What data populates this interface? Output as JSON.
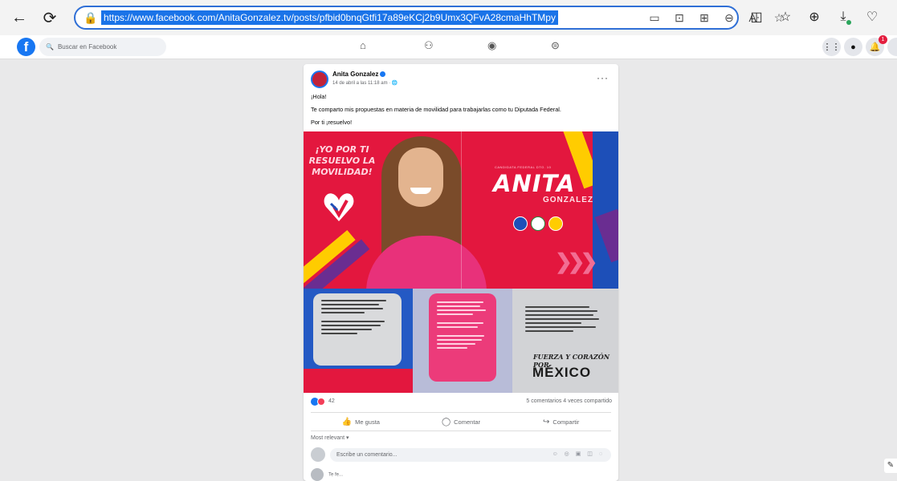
{
  "browser": {
    "url": "https://www.facebook.com/AnitaGonzalez.tv/posts/pfbid0bnqGtfi17a89eKCj2b9Umx3QFvA28cmaHhTMpy",
    "back_icon": "←",
    "reload_icon": "⟳"
  },
  "facebook": {
    "search_placeholder": "Buscar en Facebook",
    "notification_count": "1"
  },
  "post": {
    "author": "Anita Gonzalez",
    "date": "14 de abril a las 11:18 am · 🌐",
    "more": "···",
    "text_line1": "¡Hola!",
    "text_line2": "Te comparto mis propuestas en materia de movilidad para trabajarlas como tu Diputada Federal.",
    "text_line3": "Por ti ¡resuelvo!"
  },
  "campaign": {
    "slogan": "¡YO POR TI RESUELVO LA MOVILIDAD!",
    "subtitle": "CANDIDATA FEDERAL DTO. 10",
    "first_name": "ANITA",
    "last_name": "GONZALEZ",
    "fuerza": "FUERZA Y CORAZÓN POR",
    "mexico": "MÉXICO"
  },
  "reactions": {
    "count": "42",
    "stats": "5 comentarios  4 veces compartido"
  },
  "actions": {
    "like": "Me gusta",
    "comment": "Comentar",
    "share": "Compartir"
  },
  "comments": {
    "filter": "Most relevant ▾",
    "placeholder": "Escribe un comentario...",
    "icons": "☺ ◎ ▣ ◫ ◌",
    "first_reply": "Te fe..."
  },
  "colors": {
    "accent": "#1877f2",
    "campaign_red": "#e3173e",
    "highlight": "#1a73e8"
  }
}
